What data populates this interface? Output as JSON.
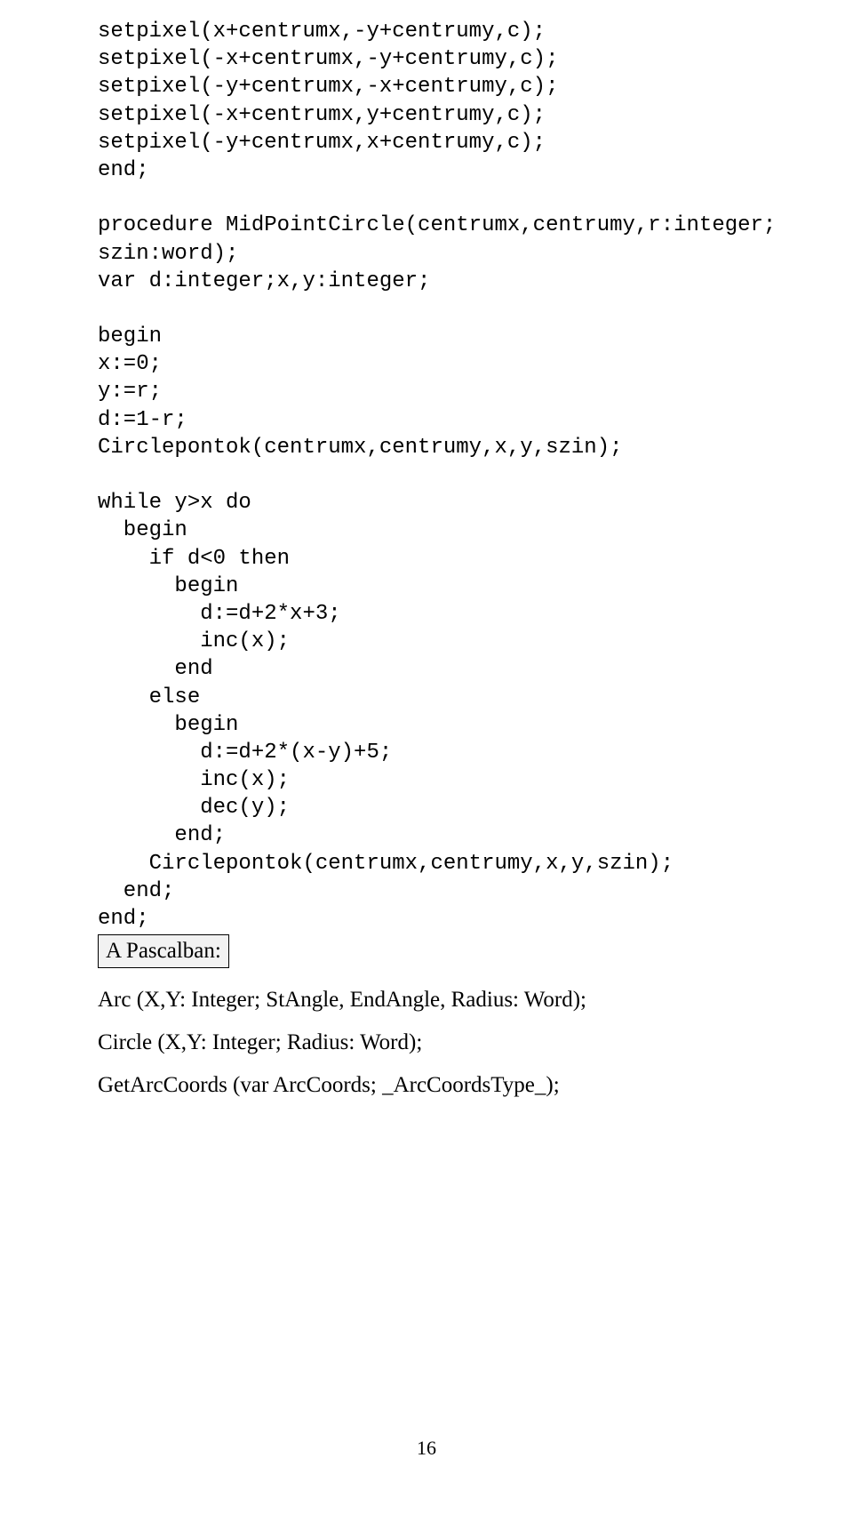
{
  "code": {
    "l01": "setpixel(x+centrumx,-y+centrumy,c);",
    "l02": "setpixel(-x+centrumx,-y+centrumy,c);",
    "l03": "setpixel(-y+centrumx,-x+centrumy,c);",
    "l04": "setpixel(-x+centrumx,y+centrumy,c);",
    "l05": "setpixel(-y+centrumx,x+centrumy,c);",
    "l06": "end;",
    "l07": "",
    "l08": "procedure MidPointCircle(centrumx,centrumy,r:integer;",
    "l09": "szin:word);",
    "l10": "var d:integer;x,y:integer;",
    "l11": "",
    "l12": "begin",
    "l13": "x:=0;",
    "l14": "y:=r;",
    "l15": "d:=1-r;",
    "l16": "Circlepontok(centrumx,centrumy,x,y,szin);",
    "l17": "",
    "l18": "while y>x do",
    "l19": "  begin",
    "l20": "    if d<0 then",
    "l21": "      begin",
    "l22": "        d:=d+2*x+3;",
    "l23": "        inc(x);",
    "l24": "      end",
    "l25": "    else",
    "l26": "      begin",
    "l27": "        d:=d+2*(x-y)+5;",
    "l28": "        inc(x);",
    "l29": "        dec(y);",
    "l30": "      end;",
    "l31": "    Circlepontok(centrumx,centrumy,x,y,szin);",
    "l32": "  end;",
    "l33": "end;"
  },
  "label": "A Pascalban:",
  "ref1": "Arc (X,Y: Integer; StAngle, EndAngle, Radius: Word);",
  "ref2": "Circle (X,Y: Integer; Radius: Word);",
  "ref3": "GetArcCoords (var  ArcCoords; _ArcCoordsType_);",
  "pageNumber": "16"
}
